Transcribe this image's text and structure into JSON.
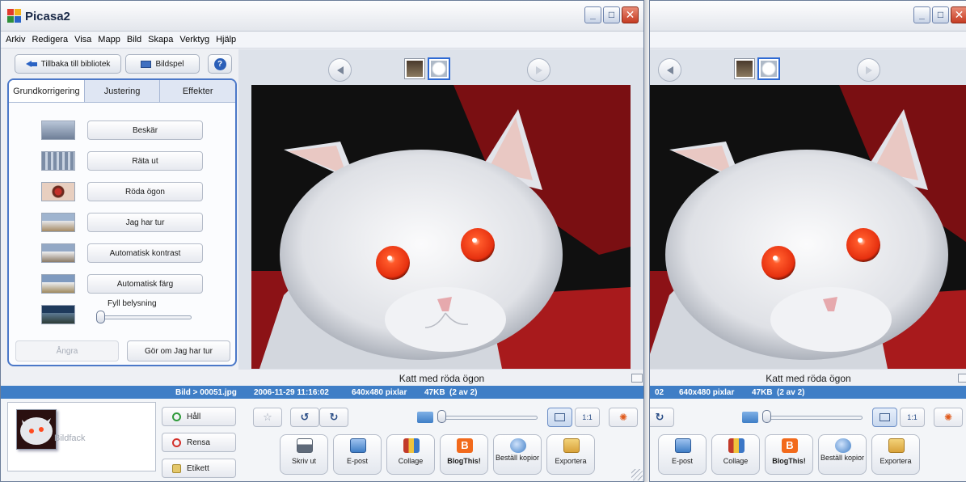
{
  "app": {
    "title": "Picasa2",
    "menu": [
      "Arkiv",
      "Redigera",
      "Visa",
      "Mapp",
      "Bild",
      "Skapa",
      "Verktyg",
      "Hjälp"
    ]
  },
  "toolbar": {
    "back_label": "Tillbaka till bibliotek",
    "slideshow_label": "Bildspel",
    "help_label": "?"
  },
  "edit_panel": {
    "tabs": [
      "Grundkorrigering",
      "Justering",
      "Effekter"
    ],
    "active_tab": "Grundkorrigering",
    "fixes": [
      "Beskär",
      "Räta ut",
      "Röda ögon",
      "Jag har tur",
      "Automatisk kontrast",
      "Automatisk färg"
    ],
    "fill_light_label": "Fyll belysning",
    "fill_light_value": 0,
    "undo_label": "Ångra",
    "redo_label": "Gör om Jag har tur"
  },
  "viewer": {
    "caption": "Katt med röda ögon",
    "info": {
      "path": "Bild > 00051.jpg",
      "date": "2006-11-29 11:16:02",
      "size": "640x480 pixlar",
      "filesize": "47KB",
      "position": "(2 av 2)"
    },
    "zoom_level": 0,
    "window2_info": {
      "path_fragment": "02",
      "size": "640x480 pixlar",
      "filesize": "47KB",
      "position": "(2 av 2)"
    }
  },
  "tray": {
    "bildfack_label": "Bildfack",
    "hold_label": "Håll",
    "clear_label": "Rensa",
    "label_label": "Etikett",
    "zoom_fit_label": "",
    "zoom_1to1_label": "1:1"
  },
  "actions": [
    "Skriv ut",
    "E-post",
    "Collage",
    "BlogThis!",
    "Beställ kopior",
    "Exportera"
  ],
  "colors": {
    "accent": "#3f7ec6",
    "tab_border": "#4b78c8",
    "red_eye": "#ff4a1f"
  }
}
